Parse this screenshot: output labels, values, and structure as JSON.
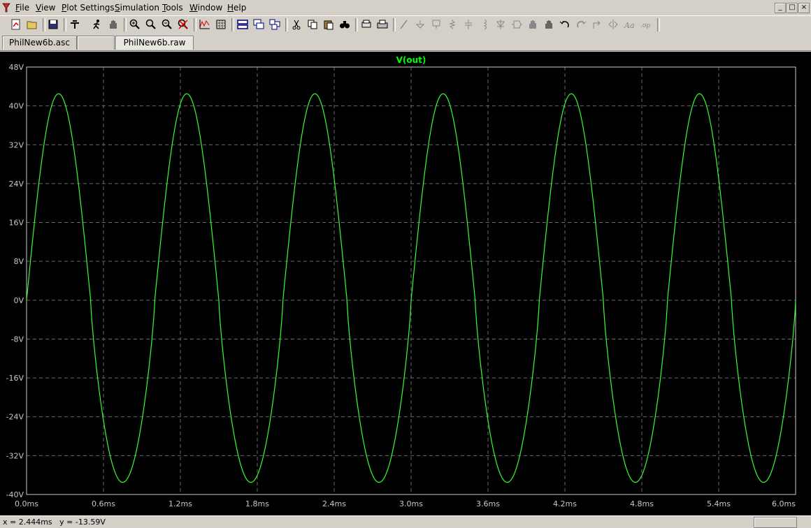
{
  "menubar": {
    "items": [
      "File",
      "View",
      "Plot Settings",
      "Simulation",
      "Tools",
      "Window",
      "Help"
    ],
    "underline": [
      "F",
      "V",
      "P",
      "S",
      "T",
      "W",
      "H"
    ],
    "win_controls": [
      "_",
      "□",
      "×"
    ]
  },
  "tabs": [
    {
      "label": "PhilNew6b.asc",
      "active": false
    },
    {
      "label": "",
      "active": false
    },
    {
      "label": "PhilNew6b.raw",
      "active": true
    }
  ],
  "chart_data": {
    "type": "line",
    "title": "V(out)",
    "title_color": "#00ff00",
    "background": "#000000",
    "trace_color": "#33ff33",
    "axis_color": "#c8c8c8",
    "xlabel": "",
    "ylabel": "",
    "grid": true,
    "grid_style": "dashed",
    "xlim": [
      0,
      6.0
    ],
    "ylim": [
      -40,
      48
    ],
    "x_ticks": [
      0.0,
      0.6,
      1.2,
      1.8,
      2.4,
      3.0,
      3.6,
      4.2,
      4.8,
      5.4,
      6.0
    ],
    "x_tick_labels": [
      "0.0ms",
      "0.6ms",
      "1.2ms",
      "1.8ms",
      "2.4ms",
      "3.0ms",
      "3.6ms",
      "4.2ms",
      "4.8ms",
      "5.4ms",
      "6.0ms"
    ],
    "y_ticks": [
      48,
      40,
      32,
      24,
      16,
      8,
      0,
      -8,
      -16,
      -24,
      -32,
      -40
    ],
    "y_tick_labels": [
      "48V",
      "40V",
      "32V",
      "24V",
      "16V",
      "8V",
      "0V",
      "-8V",
      "-16V",
      "-24V",
      "-32V",
      "-40V"
    ],
    "series": [
      {
        "name": "V(out)",
        "period_ms": 1.0,
        "peak_max_v": 42.5,
        "peak_min_v": -37.5,
        "x": [
          0.0,
          0.05,
          0.1,
          0.15,
          0.2,
          0.25,
          0.3,
          0.35,
          0.4,
          0.45,
          0.5,
          0.55,
          0.6,
          0.65,
          0.7,
          0.75,
          0.8,
          0.85,
          0.9,
          0.95,
          1.0
        ],
        "y": [
          0.0,
          13.0,
          25.0,
          34.5,
          40.5,
          42.5,
          40.5,
          34.5,
          25.0,
          13.0,
          0.0,
          -13.0,
          -25.0,
          -33.5,
          -37.0,
          -37.5,
          -37.0,
          -33.5,
          -25.0,
          -13.0,
          0.0
        ]
      }
    ]
  },
  "status": {
    "text": "x = 2.444ms   y = -13.59V"
  }
}
